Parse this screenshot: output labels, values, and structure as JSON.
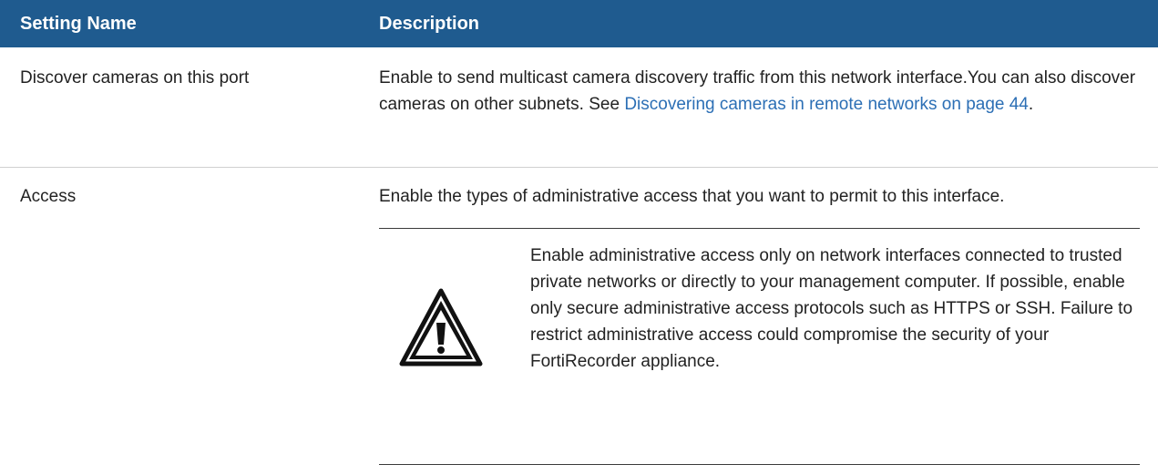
{
  "table": {
    "headers": [
      "Setting Name",
      "Description"
    ],
    "rows": [
      {
        "name": "Discover cameras on this port",
        "description_pre": "Enable to send multicast camera discovery traffic from this network interface.You can also discover cameras on other subnets. See ",
        "description_link": "Discovering cameras in remote networks on page 44",
        "description_post": "."
      },
      {
        "name": "Access",
        "description": "Enable the types of administrative access that you want to permit to this interface.",
        "warning": "Enable administrative access only on network interfaces connected to trusted private networks or directly to your management computer. If possible, enable only secure administrative access protocols such as HTTPS or SSH. Failure to restrict administrative access could compromise the security of your FortiRecorder appliance."
      }
    ]
  },
  "colors": {
    "header_bg": "#1f5b8f",
    "link": "#2c6fb5"
  },
  "icons": {
    "warning": "warning-triangle-icon"
  }
}
